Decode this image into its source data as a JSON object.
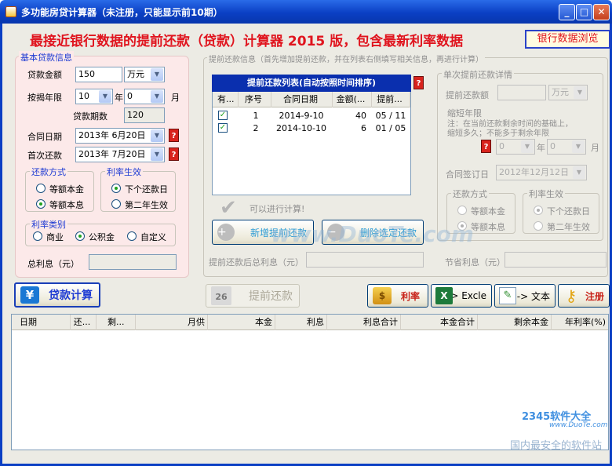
{
  "window": {
    "title": "多功能房贷计算器（未注册，只能显示前10期）",
    "min_label": "_",
    "max_label": "□",
    "close_label": "✕"
  },
  "headline": "最接近银行数据的提前还款（贷款）计算器 2015 版，包含最新利率数据",
  "top_button": "银行数据浏览",
  "basic": {
    "title": "基本贷款信息",
    "amount_label": "贷款金额",
    "amount_value": "150",
    "amount_unit": "万元",
    "term_label": "按揭年限",
    "term_years": "10",
    "year_char": "年",
    "term_months": "0",
    "month_char": "月",
    "periods_label": "贷款期数",
    "periods_value": "120",
    "contract_label": "合同日期",
    "contract_value": "2013年 6月20日",
    "first_label": "首次还款",
    "first_value": "2013年 7月20日",
    "method_title": "还款方式",
    "method_opt1": "等额本金",
    "method_opt2": "等额本息",
    "rate_effect_title": "利率生效",
    "rate_opt1": "下个还款日",
    "rate_opt2": "第二年生效",
    "rate_type_title": "利率类别",
    "type_opt1": "商业",
    "type_opt2": "公积金",
    "type_opt3": "自定义",
    "total_interest_label": "总利息（元）"
  },
  "prepay": {
    "title": "提前还款信息（首先增加提前还款，并在列表右侧填写相关信息，再进行计算）",
    "list_title": "提前还款列表(自动按照时间排序)",
    "headers": [
      "有...",
      "序号",
      "合同日期",
      "金额(...",
      "提前..."
    ],
    "rows": [
      {
        "no": "1",
        "date": "2014-9-10",
        "amount": "40",
        "period": "05 / 11"
      },
      {
        "no": "2",
        "date": "2014-10-10",
        "amount": "6",
        "period": "01 / 05"
      }
    ],
    "ok_text": "可以进行计算!",
    "add_button": "新增提前还款",
    "delete_button": "删除选定还款",
    "after_interest_label": "提前还款后总利息（元）",
    "saved_label": "节省利息（元）"
  },
  "single": {
    "title": "单次提前还款详情",
    "amount_label": "提前还款额",
    "unit": "万元",
    "shorten_label": "缩短年限",
    "note_line1": "注：在当前还款剩余时间的基础上，",
    "note_line2": "缩短多久；不能多于剩余年限",
    "years_value": "0",
    "year_char": "年",
    "months_value": "0",
    "month_char": "月",
    "sign_date_label": "合同签订日",
    "sign_date_value": "2012年12月12日",
    "method_title": "还款方式",
    "method_opt1": "等额本金",
    "method_opt2": "等额本息",
    "effect_title": "利率生效",
    "effect_opt1": "下个还款日",
    "effect_opt2": "第二年生效"
  },
  "toolbar": {
    "calc_button": "贷款计算",
    "prepay_button": "提前还款",
    "calendar_day": "26",
    "rate_button": "利率",
    "excel_button": "-> Excle",
    "text_button": "-> 文本",
    "register_button": "注册"
  },
  "results": {
    "headers": [
      "日期",
      "还...",
      "剩...",
      "月供",
      "本金",
      "利息",
      "利息合计",
      "本金合计",
      "剩余本金",
      "年利率(%)"
    ]
  },
  "watermark": {
    "site": "www.DuoTe.com",
    "logo": "2345软件大全",
    "slogan": "国内最安全的软件站"
  },
  "colors": {
    "titlebar": "#0a3fc4",
    "headline": "#e0141e",
    "accent": "#1e3bd3",
    "panel": "#fce9e9"
  }
}
